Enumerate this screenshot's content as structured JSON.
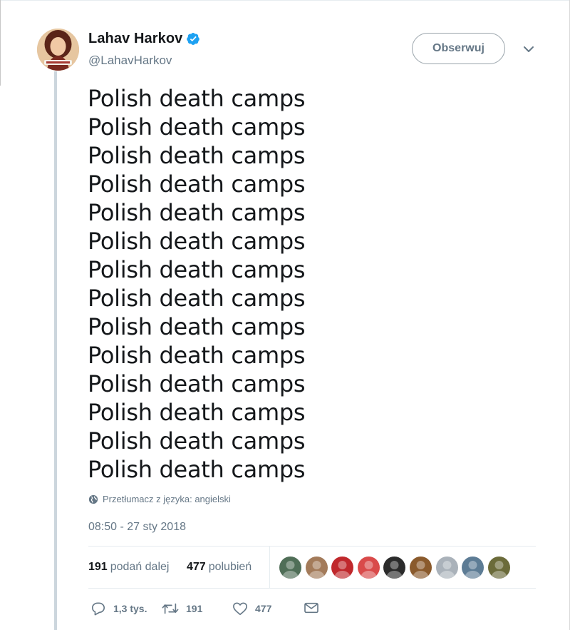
{
  "author": {
    "display_name": "Lahav Harkov",
    "username": "@LahavHarkov",
    "verified": true
  },
  "follow_button": {
    "label": "Obserwuj"
  },
  "tweet": {
    "lines": [
      "Polish death camps",
      "Polish death camps",
      "Polish death camps",
      "Polish death camps",
      "Polish death camps",
      "Polish death camps",
      "Polish death camps",
      "Polish death camps",
      "Polish death camps",
      "Polish death camps",
      "Polish death camps",
      "Polish death camps",
      "Polish death camps",
      "Polish death camps"
    ],
    "translate_label": "Przetłumacz z języka: angielski",
    "timestamp": "08:50 - 27 sty 2018"
  },
  "stats": {
    "retweets_count": "191",
    "retweets_label": "podań dalej",
    "likes_count": "477",
    "likes_label": "polubień",
    "liker_avatar_colors": [
      "#4f6e57",
      "#a37b5a",
      "#c0282c",
      "#d94a4a",
      "#2b2b2b",
      "#8a5a2c",
      "#aab2ba",
      "#5d7c95",
      "#6b6b3a"
    ]
  },
  "actions": {
    "replies": "1,3 tys.",
    "retweets": "191",
    "likes": "477"
  },
  "colors": {
    "text_primary": "#14171a",
    "text_secondary": "#657786",
    "verified_blue": "#1da1f2",
    "thread_line": "#ccd6dd"
  }
}
